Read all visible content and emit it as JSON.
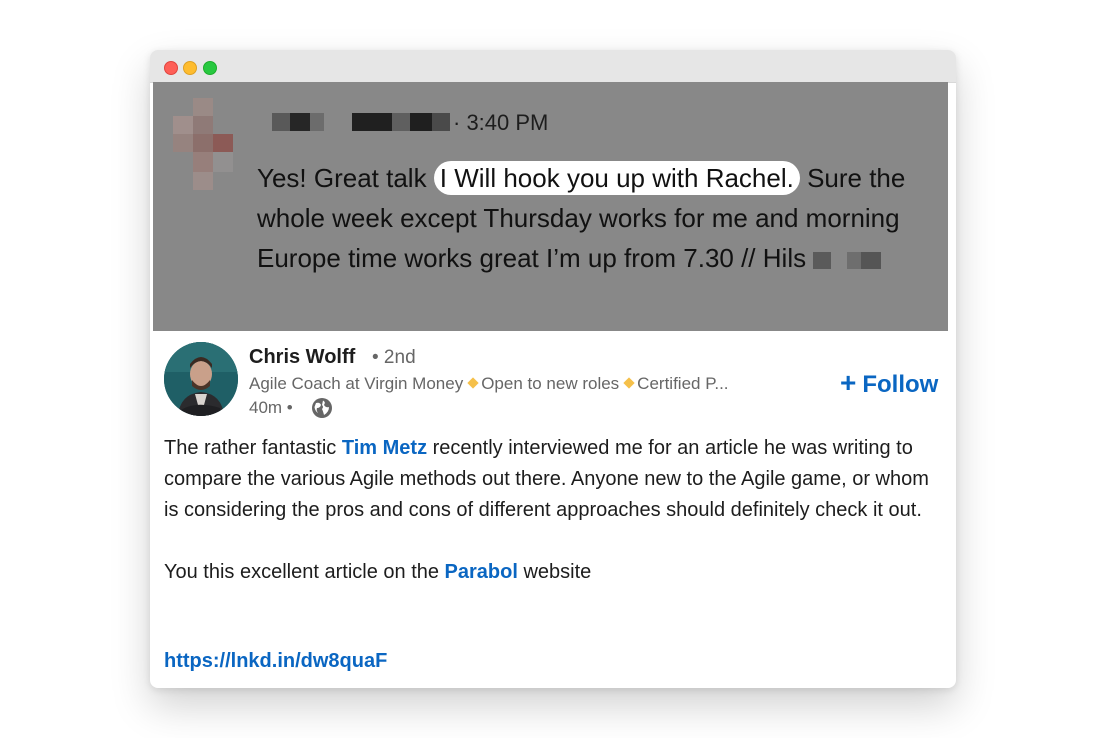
{
  "message": {
    "time": "· 3:40 PM",
    "text_before": "Yes! Great talk ",
    "highlight": "I Will hook you up with Rachel.",
    "text_after": " Sure the whole week except Thursday works for me and morning Europe time works great I’m up from 7.30 // ",
    "signoff": "Hils"
  },
  "post": {
    "author": {
      "name": "Chris Wolff",
      "degree": "• 2nd",
      "headline_role": "Agile Coach at Virgin Money",
      "headline_open": "Open to new roles",
      "headline_cert": "Certified P...",
      "time": "40m •"
    },
    "follow_label": "Follow",
    "follow_symbol": "+",
    "body": {
      "p1_before": "The rather fantastic ",
      "p1_link": "Tim Metz",
      "p1_after": " recently interviewed me for an article he was writing to compare the various Agile methods out there. Anyone new to the Agile game, or whom is considering the pros and cons of different approaches should definitely check it out.",
      "p2_before": "You this excellent article on the ",
      "p2_link": "Parabol",
      "p2_after": " website"
    },
    "url": "https://lnkd.in/dw8quaF"
  },
  "colors": {
    "link": "#0a66c2",
    "message_bg": "#888888",
    "highlight": "#ffffff",
    "badge_diamond": "#f5c04a"
  },
  "icons": {
    "window_close": "close-dot-icon",
    "window_minimize": "minimize-dot-icon",
    "window_zoom": "zoom-dot-icon",
    "visibility": "globe-icon",
    "follow": "plus-icon"
  }
}
